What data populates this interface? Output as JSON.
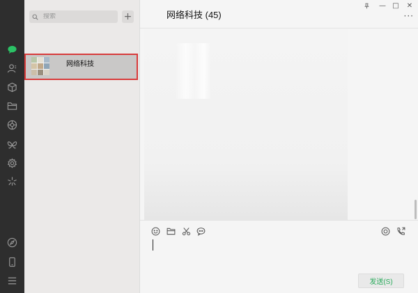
{
  "search": {
    "placeholder": "搜索"
  },
  "add_button": {
    "label": "+"
  },
  "chat_list": [
    {
      "name": "网络科技",
      "selected": true
    }
  ],
  "chat": {
    "title": "网络科技 (45)"
  },
  "window_controls": {
    "pin": "⊥",
    "minimize": "—",
    "maximize": "□",
    "close": "✕",
    "more": "···"
  },
  "compose": {
    "send_label": "发送(S)"
  },
  "colors": {
    "rail": "#2e2e2e",
    "accent_green": "#2bab5c",
    "selection_border": "#d83a3a"
  },
  "icons": {
    "rail": [
      "chat-icon",
      "contacts-icon",
      "box-icon",
      "folder-icon",
      "moments-icon",
      "butterfly-icon",
      "settings-gear-icon",
      "sparkle-icon",
      "compass-icon",
      "phone-icon",
      "menu-icon"
    ],
    "toolbar": [
      "emoji-icon",
      "folder-icon",
      "scissors-icon",
      "chat-bubble-icon",
      "live-icon",
      "call-icon"
    ]
  }
}
